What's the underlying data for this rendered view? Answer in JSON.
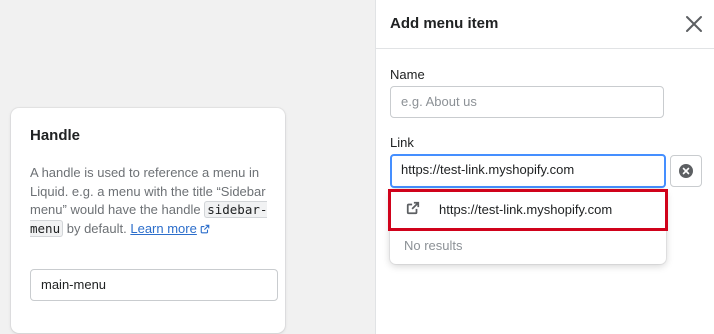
{
  "handle_card": {
    "title": "Handle",
    "description_pre": "A handle is used to reference a menu in Liquid. e.g. a menu with the title “Sidebar menu” would have the handle",
    "code": "sidebar-menu",
    "description_post": "by default.",
    "learn_more": "Learn more",
    "handle_value": "main-menu"
  },
  "sheet": {
    "title": "Add menu item",
    "name_label": "Name",
    "name_placeholder": "e.g. About us",
    "link_label": "Link",
    "link_value": "https://test-link.myshopify.com",
    "suggestion": "https://test-link.myshopify.com",
    "no_results": "No results"
  },
  "colors": {
    "accent_link": "#2c6ecb",
    "focus_border": "#458fff",
    "highlight_annotation": "#d0021b"
  }
}
